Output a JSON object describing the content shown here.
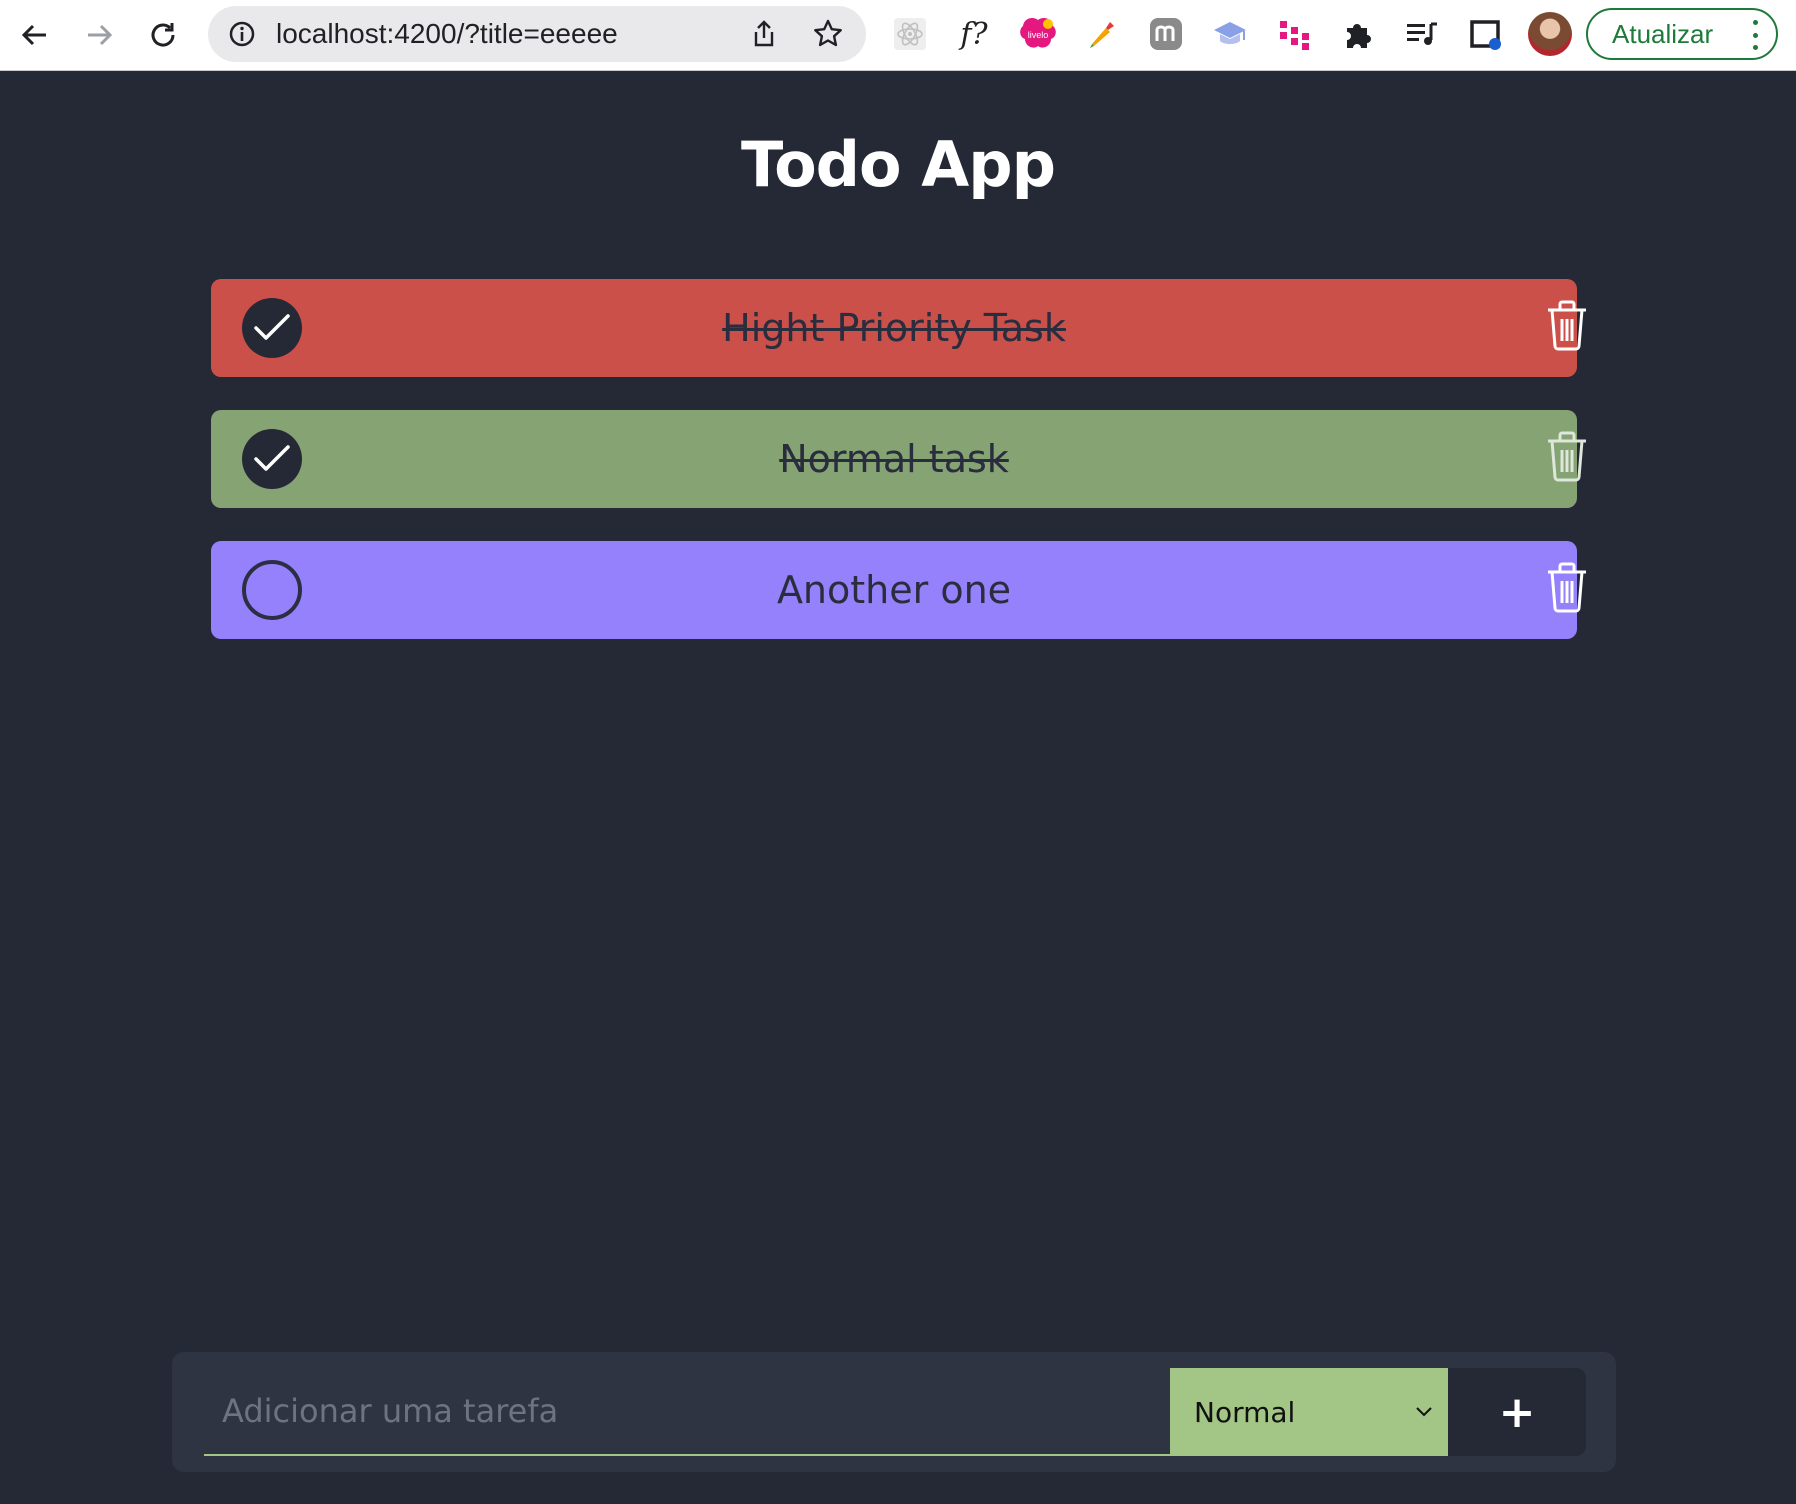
{
  "browser": {
    "url": "localhost:4200/?title=eeeee",
    "update_label": "Atualizar",
    "extensions": [
      "react-devtools-icon",
      "fontfinder-icon",
      "livelo-icon",
      "colorpicker-icon",
      "m-extension-icon",
      "graduation-cap-icon",
      "dots-extension-icon",
      "puzzle-icon",
      "media-queue-icon",
      "window-icon"
    ],
    "fontfinder_text": "f?",
    "livelo_text": "livelo"
  },
  "app": {
    "title": "Todo App"
  },
  "tasks": [
    {
      "label": "Hight Priority Task",
      "done": true,
      "color": "#cb5049",
      "priority": "high"
    },
    {
      "label": "Normal task",
      "done": true,
      "color": "#86a373",
      "priority": "normal"
    },
    {
      "label": "Another one",
      "done": false,
      "color": "#9481fb",
      "priority": "low"
    }
  ],
  "add_form": {
    "placeholder": "Adicionar uma tarefa",
    "priority_selected": "Normal",
    "add_button_symbol": "+"
  },
  "colors": {
    "background": "#252935",
    "bar": "#2f3443",
    "select": "#a3c585",
    "update_green": "#1e7a3a"
  }
}
